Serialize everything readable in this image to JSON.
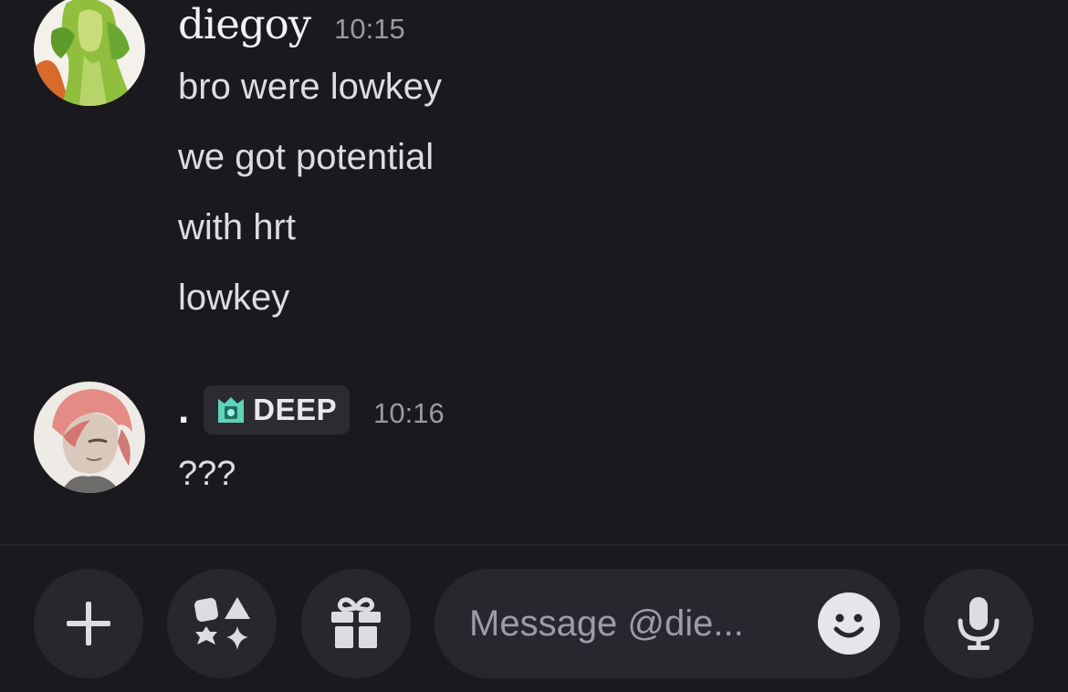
{
  "messages": [
    {
      "author": "diegoy",
      "timestamp": "10:15",
      "lines": [
        "bro were lowkey",
        "we got potential",
        "with hrt",
        "lowkey"
      ]
    },
    {
      "author": ".",
      "tag": "DEEP",
      "timestamp": "10:16",
      "lines": [
        "???"
      ]
    }
  ],
  "composer": {
    "placeholder": "Message @die..."
  },
  "colors": {
    "background": "#1a1a1e",
    "button_bg": "#27272d",
    "tag_accent": "#5fd3b8"
  },
  "icons": {
    "add": "plus-icon",
    "apps": "apps-shapes-icon",
    "gift": "gift-icon",
    "emoji": "smile-emoji-icon",
    "voice": "microphone-icon",
    "tag": "guild-tag-icon"
  }
}
